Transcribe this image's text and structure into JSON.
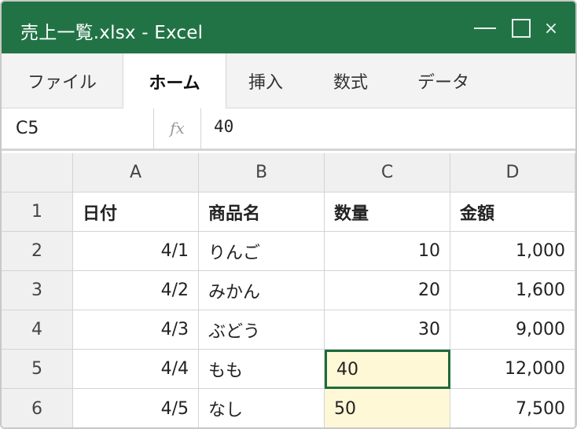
{
  "window": {
    "title": "売上一覧.xlsx - Excel",
    "min_glyph": "—",
    "close_glyph": "×"
  },
  "ribbon": {
    "tabs": [
      "ファイル",
      "ホーム",
      "挿入",
      "数式",
      "データ"
    ],
    "active_tab": "ホーム"
  },
  "formula_bar": {
    "cell_ref": "C5",
    "fx_label": "fx",
    "value": "40"
  },
  "sheet": {
    "columns": [
      "A",
      "B",
      "C",
      "D"
    ],
    "rows": [
      {
        "num": "1",
        "cells": [
          "日付",
          "商品名",
          "数量",
          "金額"
        ]
      },
      {
        "num": "2",
        "cells": [
          "4/1",
          "りんご",
          "10",
          "1,000"
        ]
      },
      {
        "num": "3",
        "cells": [
          "4/2",
          "みかん",
          "20",
          "1,600"
        ]
      },
      {
        "num": "4",
        "cells": [
          "4/3",
          "ぶどう",
          "30",
          "9,000"
        ]
      },
      {
        "num": "5",
        "cells": [
          "4/4",
          "もも",
          "40",
          "12,000"
        ]
      },
      {
        "num": "6",
        "cells": [
          "4/5",
          "なし",
          "50",
          "7,500"
        ]
      }
    ],
    "active_cell": "C5",
    "highlight_color": "#fff8d6",
    "accent_color": "#217346"
  }
}
